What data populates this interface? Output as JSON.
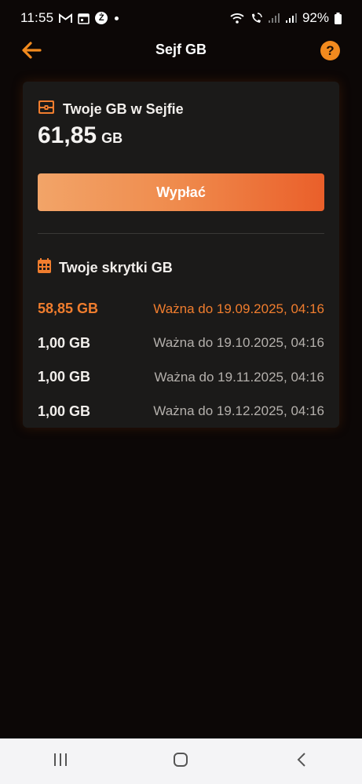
{
  "status_bar": {
    "time": "11:55",
    "battery": "92%",
    "icons": [
      "gmail-icon",
      "calendar-icon",
      "z-app-icon",
      "notification-dot-icon",
      "wifi-icon",
      "wifi-calling-icon",
      "signal-icon",
      "signal-icon",
      "battery-icon"
    ],
    "z_badge": "Ż"
  },
  "header": {
    "title": "Sejf GB",
    "back_icon": "arrow-left-icon",
    "help_icon": "question-mark-icon",
    "help_glyph": "?"
  },
  "safe": {
    "title": "Twoje GB w Sejfie",
    "icon": "treasure-chest-icon",
    "balance_value": "61,85",
    "balance_unit": "GB",
    "withdraw_label": "Wypłać"
  },
  "hides": {
    "title": "Twoje skrytki GB",
    "icon": "calendar-icon",
    "items": [
      {
        "amount": "58,85 GB",
        "expiry": "Ważna do 19.09.2025, 04:16"
      },
      {
        "amount": "1,00 GB",
        "expiry": "Ważna do 19.10.2025, 04:16"
      },
      {
        "amount": "1,00 GB",
        "expiry": "Ważna do 19.11.2025, 04:16"
      },
      {
        "amount": "1,00 GB",
        "expiry": "Ważna do 19.12.2025, 04:16"
      }
    ]
  },
  "colors": {
    "accent": "#f07d2e",
    "background": "#0c0706",
    "card": "#1b1a19",
    "button_gradient_start": "#f2a468",
    "button_gradient_end": "#ea5f2a",
    "nav_bar": "#f4f4f6"
  },
  "nav_bar": {
    "icons": [
      "recent-apps-icon",
      "home-icon",
      "back-icon"
    ]
  }
}
